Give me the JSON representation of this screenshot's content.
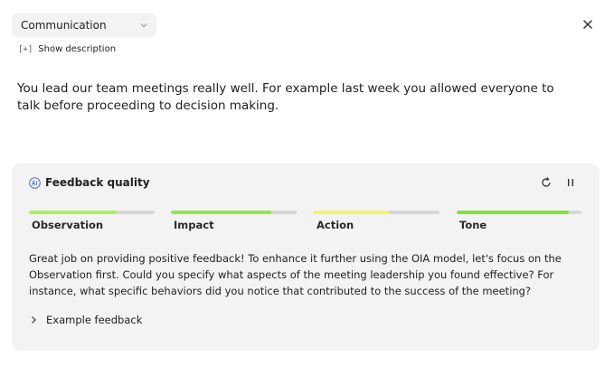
{
  "dropdown": {
    "selected": "Communication",
    "icon": "chevron-down-icon"
  },
  "close": {
    "icon": "close-icon"
  },
  "description": {
    "toggle_marker": "[+]",
    "label": "Show description"
  },
  "message": {
    "text": "You lead our team meetings really well. For example last week you allowed everyone to talk before proceeding to decision making."
  },
  "feedback_panel": {
    "title": "Feedback quality",
    "title_icon": "ai-icon",
    "actions": [
      "refresh-icon",
      "pause-icon"
    ],
    "meters": [
      {
        "label": "Observation",
        "level": 0.7,
        "color": "#aef05a"
      },
      {
        "label": "Impact",
        "level": 0.8,
        "color": "#92e84a"
      },
      {
        "label": "Action",
        "level": 0.6,
        "color": "#f2f566"
      },
      {
        "label": "Tone",
        "level": 0.9,
        "color": "#7fe33a"
      }
    ],
    "advice": "Great job on providing positive feedback! To enhance it further using the OIA model, let's focus on the Observation first. Could you specify what aspects of the meeting leadership you found effective? For instance, what specific behaviors did you notice that contributed to the success of the meeting?",
    "example_label": "Example feedback",
    "example_icon": "chevron-right-icon"
  }
}
